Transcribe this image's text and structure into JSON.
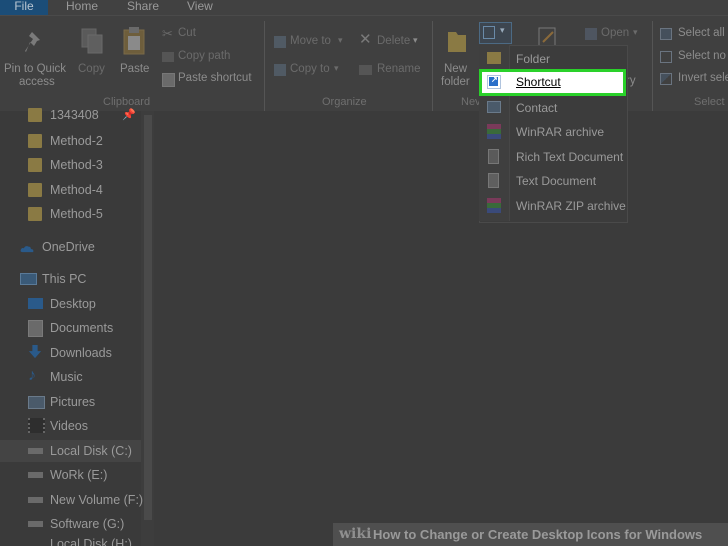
{
  "tabs": [
    "File",
    "Home",
    "Share",
    "View"
  ],
  "ribbon": {
    "clipboard": {
      "pin": "Pin to Quick access",
      "pin_l1": "Pin to Quick",
      "pin_l2": "access",
      "copy": "Copy",
      "paste": "Paste",
      "cut": "Cut",
      "copy_path": "Copy path",
      "paste_shortcut": "Paste shortcut",
      "group": "Clipboard"
    },
    "organize": {
      "move_to": "Move to",
      "copy_to": "Copy to",
      "delete": "Delete",
      "rename": "Rename",
      "group": "Organize"
    },
    "new": {
      "new_folder_l1": "New",
      "new_folder_l2": "folder",
      "group": "Nev"
    },
    "open": {
      "open": "Open",
      "partial_ry": "ry"
    },
    "select": {
      "select_all": "Select all",
      "select_none": "Select no",
      "invert": "Invert sele",
      "group": "Select"
    }
  },
  "nav": {
    "items": [
      {
        "label": "1343408",
        "icon": "folder-icon"
      },
      {
        "label": "Method-2",
        "icon": "folder-icon"
      },
      {
        "label": "Method-3",
        "icon": "folder-icon"
      },
      {
        "label": "Method-4",
        "icon": "folder-icon"
      },
      {
        "label": "Method-5",
        "icon": "folder-icon"
      },
      {
        "label": "OneDrive",
        "icon": "cloud-icon"
      },
      {
        "label": "This PC",
        "icon": "computer-icon"
      },
      {
        "label": "Desktop",
        "icon": "desktop-icon"
      },
      {
        "label": "Documents",
        "icon": "documents-icon"
      },
      {
        "label": "Downloads",
        "icon": "download-arrow-icon"
      },
      {
        "label": "Music",
        "icon": "music-note-icon"
      },
      {
        "label": "Pictures",
        "icon": "pictures-icon"
      },
      {
        "label": "Videos",
        "icon": "film-icon"
      },
      {
        "label": "Local Disk (C:)",
        "icon": "drive-icon"
      },
      {
        "label": "WoRk (E:)",
        "icon": "drive-icon"
      },
      {
        "label": "New Volume (F:)",
        "icon": "drive-icon"
      },
      {
        "label": "Software (G:)",
        "icon": "drive-icon"
      },
      {
        "label": "Local Disk (H:)",
        "icon": "drive-icon"
      }
    ]
  },
  "new_item_menu": {
    "items": [
      {
        "label": "Folder",
        "icon": "folder-icon"
      },
      {
        "label": "Shortcut",
        "icon": "shortcut-icon"
      },
      {
        "label": "Contact",
        "icon": "contact-card-icon"
      },
      {
        "label": "WinRAR archive",
        "icon": "winrar-icon"
      },
      {
        "label": "Rich Text Document",
        "icon": "rtf-document-icon"
      },
      {
        "label": "Text Document",
        "icon": "text-document-icon"
      },
      {
        "label": "WinRAR ZIP archive",
        "icon": "winrar-zip-icon"
      }
    ],
    "highlighted": "Shortcut"
  },
  "caption": {
    "wiki": "wiki",
    "title": "How to Change or Create Desktop Icons for Windows"
  },
  "colors": {
    "highlight_border": "#2ad12a",
    "file_tab": "#1b4d78"
  }
}
